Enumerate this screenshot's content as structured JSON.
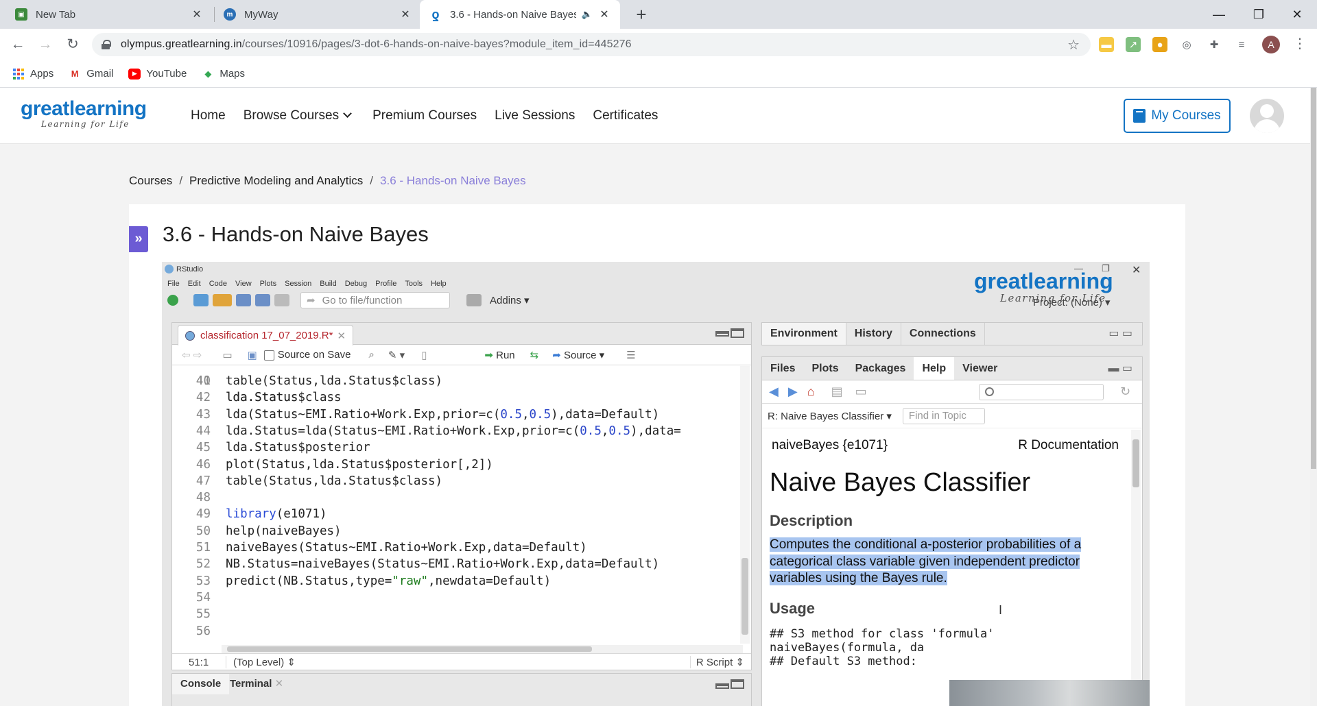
{
  "browser": {
    "tabs": [
      {
        "label": "New Tab",
        "active": false
      },
      {
        "label": "MyWay",
        "active": false
      },
      {
        "label": "3.6 - Hands-on Naive Bayes",
        "active": true
      }
    ],
    "url_host": "olympus.greatlearning.in",
    "url_path": "/courses/10916/pages/3-dot-6-hands-on-naive-bayes?module_item_id=445276",
    "profile_initial": "A",
    "bookmarks": [
      "Apps",
      "Gmail",
      "YouTube",
      "Maps"
    ]
  },
  "site": {
    "logo_word": "greatlearning",
    "logo_tagline": "Learning for Life",
    "nav": [
      "Home",
      "Browse Courses",
      "Premium Courses",
      "Live Sessions",
      "Certificates"
    ],
    "my_courses": "My Courses",
    "brand_color": "#1474c4",
    "accent_color": "#6c5bd4"
  },
  "breadcrumb": {
    "items": [
      "Courses",
      "Predictive Modeling and Analytics"
    ],
    "current": "3.6 - Hands-on Naive Bayes",
    "separator": "/"
  },
  "page": {
    "title": "3.6 - Hands-on Naive Bayes",
    "expand_glyph": "»"
  },
  "rstudio": {
    "app_name": "RStudio",
    "menu": [
      "File",
      "Edit",
      "Code",
      "View",
      "Plots",
      "Session",
      "Build",
      "Debug",
      "Profile",
      "Tools",
      "Help"
    ],
    "goto_placeholder": "Go to file/function",
    "addins": "Addins",
    "project": "Project: (None)",
    "watermark_word": "greatlearning",
    "watermark_tagline": "Learning for Life",
    "editor": {
      "file_tab": "classification 17_07_2019.R*",
      "source_on_save": "Source on Save",
      "run": "Run",
      "source": "Source",
      "partial_line": "lda.Status$class",
      "lines": [
        {
          "n": "41",
          "code": "table(Status,lda.Status$class)"
        },
        {
          "n": "42",
          "code": "lda.Status"
        },
        {
          "n": "43",
          "code": "lda(Status~EMI.Ratio+Work.Exp,prior=c(0.5,0.5),data=Default)"
        },
        {
          "n": "44",
          "code": "lda.Status=lda(Status~EMI.Ratio+Work.Exp,prior=c(0.5,0.5),data="
        },
        {
          "n": "45",
          "code": "lda.Status$posterior"
        },
        {
          "n": "46",
          "code": "plot(Status,lda.Status$posterior[,2])"
        },
        {
          "n": "47",
          "code": "table(Status,lda.Status$class)"
        },
        {
          "n": "48",
          "code": ""
        },
        {
          "n": "49",
          "code": "library(e1071)"
        },
        {
          "n": "50",
          "code": "help(naiveBayes)"
        },
        {
          "n": "51",
          "code": "naiveBayes(Status~EMI.Ratio+Work.Exp,data=Default)"
        },
        {
          "n": "52",
          "code": "NB.Status=naiveBayes(Status~EMI.Ratio+Work.Exp,data=Default)"
        },
        {
          "n": "53",
          "code": "predict(NB.Status,type=\"raw\",newdata=Default)"
        },
        {
          "n": "54",
          "code": ""
        },
        {
          "n": "55",
          "code": ""
        },
        {
          "n": "56",
          "code": ""
        }
      ],
      "cursor_pos": "51:1",
      "scope": "(Top Level)",
      "file_type": "R Script"
    },
    "console_tabs": [
      "Console",
      "Terminal"
    ],
    "env_tabs": [
      "Environment",
      "History",
      "Connections"
    ],
    "files_tabs": [
      "Files",
      "Plots",
      "Packages",
      "Help",
      "Viewer"
    ],
    "help": {
      "topic": "R: Naive Bayes Classifier",
      "find_placeholder": "Find in Topic",
      "pkg": "naiveBayes {e1071}",
      "rdoc": "R Documentation",
      "heading": "Naive Bayes Classifier",
      "description_title": "Description",
      "description": "Computes the conditional a-posterior probabilities of a categorical class variable given independent predictor variables using the Bayes rule.",
      "usage_title": "Usage",
      "usage_line1": "## S3 method for class 'formula'",
      "usage_line2": "naiveBayes(formula, da",
      "usage_line3": "## Default S3 method:"
    }
  }
}
